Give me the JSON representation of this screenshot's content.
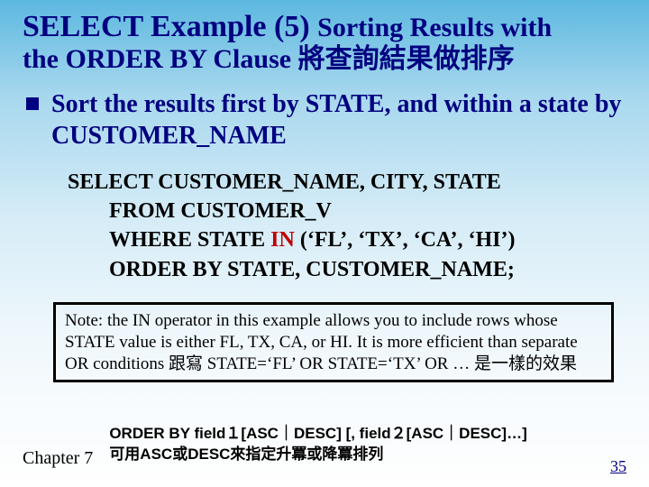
{
  "title": {
    "part1": "SELECT Example (5) ",
    "part2": "Sorting Results with",
    "line2": "the ORDER BY Clause 將查詢結果做排序"
  },
  "bullet": "Sort the results first by STATE, and within a state by CUSTOMER_NAME",
  "code": {
    "l1": "SELECT CUSTOMER_NAME, CITY, STATE",
    "l2": "FROM CUSTOMER_V",
    "l3a": "WHERE STATE ",
    "l3_in": "IN",
    "l3b": " (‘FL’, ‘TX’, ‘CA’, ‘HI’)",
    "l4": "ORDER BY STATE, CUSTOMER_NAME;"
  },
  "note": "Note: the IN operator in this example allows you to include rows whose STATE value is either FL, TX, CA, or HI. It is more efficient than separate OR conditions 跟寫 STATE=‘FL’ OR STATE=‘TX’ OR … 是一樣的效果",
  "syntax": {
    "l1": "ORDER BY field１[ASC｜DESC] [, field２[ASC｜DESC]…]",
    "l2": "可用ASC或DESC來指定升冪或降冪排列"
  },
  "chapter": "Chapter 7",
  "page": "35"
}
